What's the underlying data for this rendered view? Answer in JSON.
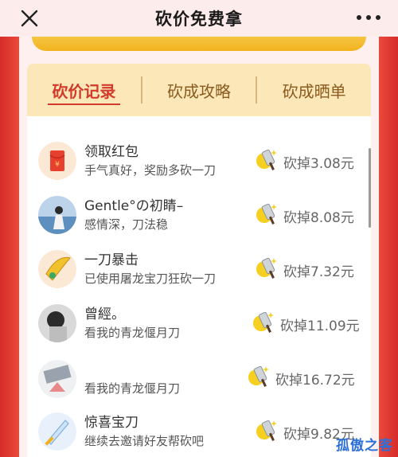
{
  "header": {
    "title": "砍价免费拿"
  },
  "tabs": [
    {
      "label": "砍价记录",
      "active": true
    },
    {
      "label": "砍成攻略",
      "active": false
    },
    {
      "label": "砍成晒单",
      "active": false
    }
  ],
  "records": [
    {
      "name": "领取红包",
      "desc": "手气真好，奖励多砍一刀",
      "amount": "砍掉3.08元",
      "avatar": "red-envelope-icon"
    },
    {
      "name": "Gentle°の初睛–",
      "desc": "感情深，刀法稳",
      "amount": "砍掉8.08元",
      "avatar": "user-avatar"
    },
    {
      "name": "一刀暴击",
      "desc": "已使用屠龙宝刀狂砍一刀",
      "amount": "砍掉7.32元",
      "avatar": "golden-blade-icon"
    },
    {
      "name": "曾經。",
      "desc": "看我的青龙偃月刀",
      "amount": "砍掉11.09元",
      "avatar": "user-avatar"
    },
    {
      "name": "",
      "desc": "看我的青龙偃月刀",
      "amount": "砍掉16.72元",
      "avatar": "user-avatar"
    },
    {
      "name": "惊喜宝刀",
      "desc": "继续去邀请好友帮砍吧",
      "amount": "砍掉9.82元",
      "avatar": "treasure-sword-icon"
    }
  ],
  "watermark": "孤傲之客",
  "colors": {
    "accent": "#d23a2c",
    "tab_bg": "#fbe7b7",
    "frame": "#e53935",
    "gold": "#f5c542"
  }
}
